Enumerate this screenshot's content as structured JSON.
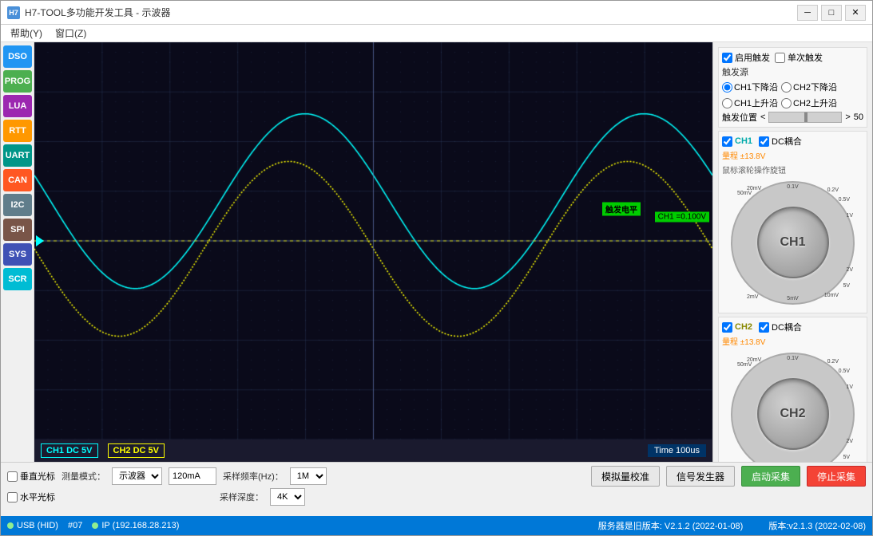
{
  "window": {
    "title": "H7-TOOL多功能开发工具 - 示波器",
    "icon_text": "H7"
  },
  "menu": {
    "items": [
      "帮助(Y)",
      "窗口(Z)"
    ]
  },
  "sidebar": {
    "buttons": [
      {
        "label": "DSO",
        "color": "#2196F3"
      },
      {
        "label": "PROG",
        "color": "#4CAF50"
      },
      {
        "label": "LUA",
        "color": "#9C27B0"
      },
      {
        "label": "RTT",
        "color": "#FF9800"
      },
      {
        "label": "UART",
        "color": "#009688"
      },
      {
        "label": "CAN",
        "color": "#FF5722"
      },
      {
        "label": "I2C",
        "color": "#607D8B"
      },
      {
        "label": "SPI",
        "color": "#795548"
      },
      {
        "label": "SYS",
        "color": "#3F51B5"
      },
      {
        "label": "SCR",
        "color": "#00BCD4"
      }
    ]
  },
  "scope": {
    "ch1": {
      "label": "CH1",
      "coupling": "DC",
      "scale": "5V",
      "color": "#00FFFF",
      "enabled": true
    },
    "ch2": {
      "label": "CH2",
      "coupling": "DC",
      "scale": "5V",
      "color": "#FFFF00",
      "enabled": true
    },
    "time": {
      "label": "Time 100us"
    },
    "trigger": {
      "label": "触发电平",
      "ch1_value": "CH1 =0.100V"
    }
  },
  "trigger_panel": {
    "enable_trigger_label": "启用触发",
    "single_trigger_label": "单次触发",
    "source_label": "触发源",
    "ch1_falling": "CH1下降沿",
    "ch2_falling": "CH2下降沿",
    "ch1_rising": "CH1上升沿",
    "ch2_rising": "CH2上升沿",
    "pos_label": "触发位置",
    "pos_value": "50",
    "ch1_label": "CH1",
    "ch2_label": "CH2",
    "dc_coupling1": "DC耦合",
    "dc_coupling2": "DC耦合",
    "range1": "量程 ±13.8V",
    "range2": "量程 ±13.8V",
    "knob_hint": "鼠标滚轮操作旋钮",
    "ch1_knob_label": "CH1",
    "ch2_knob_label": "CH2"
  },
  "bottom_controls": {
    "vertical_grid": "垂直光标",
    "horizontal_grid": "水平光标",
    "measure_mode_label": "测量模式：",
    "measure_mode": "示波器",
    "current_value": "120mA",
    "sample_rate_label": "采样频率(Hz)：",
    "sample_rate": "1M",
    "sample_depth_label": "采样深度：",
    "sample_depth": "4K",
    "calibrate_btn": "模拟量校准",
    "signal_gen_btn": "信号发生器",
    "start_btn": "启动采集",
    "stop_btn": "停止采集"
  },
  "status_bar": {
    "usb_label": "USB (HID)",
    "port": "#07",
    "ip_label": "IP (192.168.28.213)",
    "server_label": "服务器是旧版本: V2.1.2 (2022-01-08)",
    "version": "版本:v2.1.3 (2022-02-08)"
  }
}
